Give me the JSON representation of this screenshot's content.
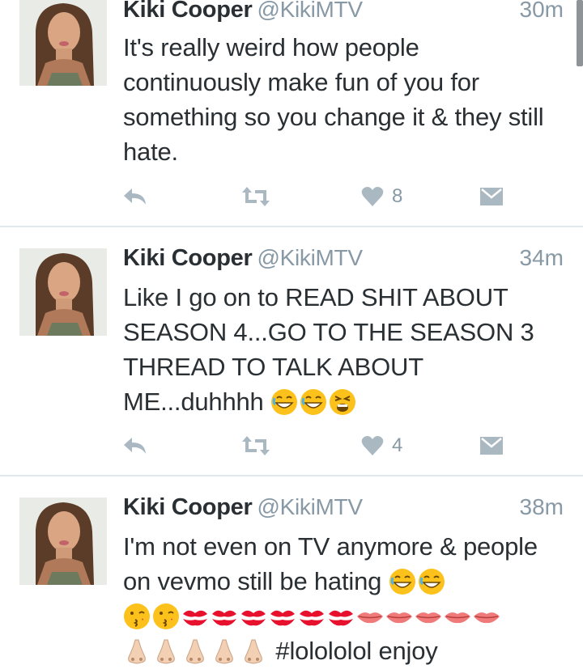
{
  "tweets": [
    {
      "name": "Kiki Cooper",
      "handle": "@KikiMTV",
      "time": "30m",
      "text_lines": [
        "It's really weird how people",
        "continuously make fun of you for",
        "something so you change it & they still",
        "hate."
      ],
      "likes": "8"
    },
    {
      "name": "Kiki Cooper",
      "handle": "@KikiMTV",
      "time": "34m",
      "text_lines": [
        "Like I go on to READ SHIT ABOUT",
        "SEASON 4...GO TO THE SEASON 3",
        "THREAD TO TALK ABOUT",
        "ME...duhhhh"
      ],
      "emojis_line4": [
        "grinning-sweat-emoji",
        "grinning-sweat-emoji",
        "tired-face-emoji"
      ],
      "likes": "4"
    },
    {
      "name": "Kiki Cooper",
      "handle": "@KikiMTV",
      "time": "38m",
      "text_lines": [
        "I'm not even on TV anymore & people",
        "on vevmo still be hating",
        "",
        "#lolololol enjoy"
      ],
      "emojis_line2": [
        "grinning-sweat-emoji",
        "grinning-sweat-emoji"
      ],
      "emojis_line3": [
        "kissing-face-emoji",
        "kissing-face-emoji",
        "kiss-mark-emoji",
        "kiss-mark-emoji",
        "kiss-mark-emoji",
        "kiss-mark-emoji",
        "kiss-mark-emoji",
        "kiss-mark-emoji",
        "lips-emoji",
        "lips-emoji",
        "lips-emoji",
        "lips-emoji",
        "lips-emoji"
      ],
      "emojis_line4": [
        "nose-emoji",
        "nose-emoji",
        "nose-emoji",
        "nose-emoji",
        "nose-emoji"
      ]
    }
  ],
  "icons": {
    "reply": "reply-icon",
    "retweet": "retweet-icon",
    "like": "heart-icon",
    "dm": "envelope-icon"
  },
  "colors": {
    "text": "#292f33",
    "muted": "#8899a6",
    "icon": "#aab8c2",
    "divider": "#e1e8ed"
  }
}
